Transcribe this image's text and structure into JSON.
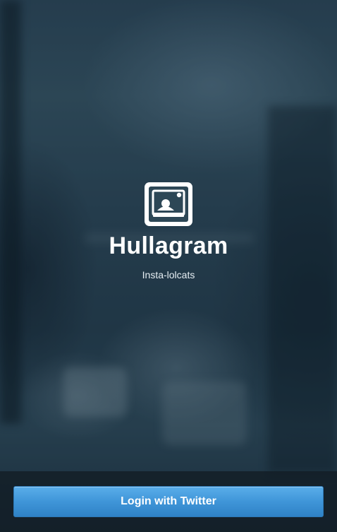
{
  "app": {
    "title": "Hullagram",
    "subtitle": "Insta-lolcats",
    "logo_icon": "camera-photo-icon"
  },
  "login": {
    "button_label": "Login with Twitter"
  },
  "colors": {
    "button_blue": "#3f95d8",
    "background_blue": "#2a4353",
    "text_white": "#ffffff"
  }
}
